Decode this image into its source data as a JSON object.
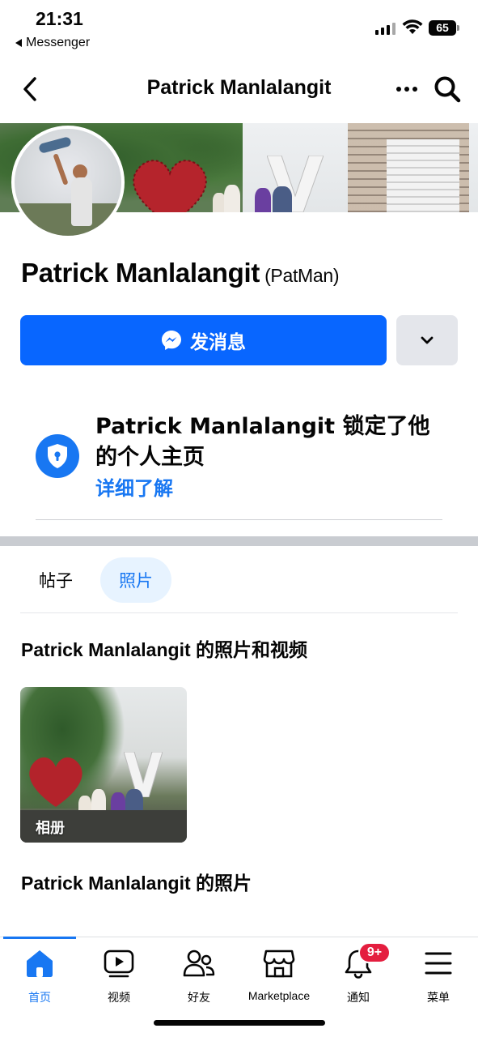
{
  "status_bar": {
    "time": "21:31",
    "back_app": "Messenger",
    "battery": "65"
  },
  "navbar": {
    "title": "Patrick Manlalangit",
    "icons": [
      "back-chevron-icon",
      "more-dots-icon",
      "search-icon"
    ]
  },
  "profile": {
    "name": "Patrick Manlalangit",
    "nickname": "(PatMan)",
    "message_button": "发消息",
    "message_icon": "messenger-icon",
    "more_icon": "chevron-down-icon"
  },
  "lock_notice": {
    "title": "Patrick Manlalangit 锁定了他的个人主页",
    "link": "详细了解",
    "icon": "shield-lock-icon"
  },
  "tabs": {
    "posts": "帖子",
    "photos": "照片",
    "active": "photos"
  },
  "sections": {
    "photos_and_videos": "Patrick Manlalangit 的照片和视频",
    "album_label": "相册",
    "photos": "Patrick Manlalangit 的照片"
  },
  "tabbar": {
    "items": [
      {
        "label": "首页",
        "icon": "home-icon",
        "active": true
      },
      {
        "label": "视频",
        "icon": "video-icon",
        "active": false
      },
      {
        "label": "好友",
        "icon": "friends-icon",
        "active": false
      },
      {
        "label": "Marketplace",
        "icon": "marketplace-icon",
        "active": false
      },
      {
        "label": "通知",
        "icon": "bell-icon",
        "active": false,
        "badge": "9+"
      },
      {
        "label": "菜单",
        "icon": "menu-icon",
        "active": false
      }
    ]
  },
  "colors": {
    "accent": "#1877f2",
    "button_blue": "#0866ff",
    "badge_red": "#e41e3f"
  }
}
